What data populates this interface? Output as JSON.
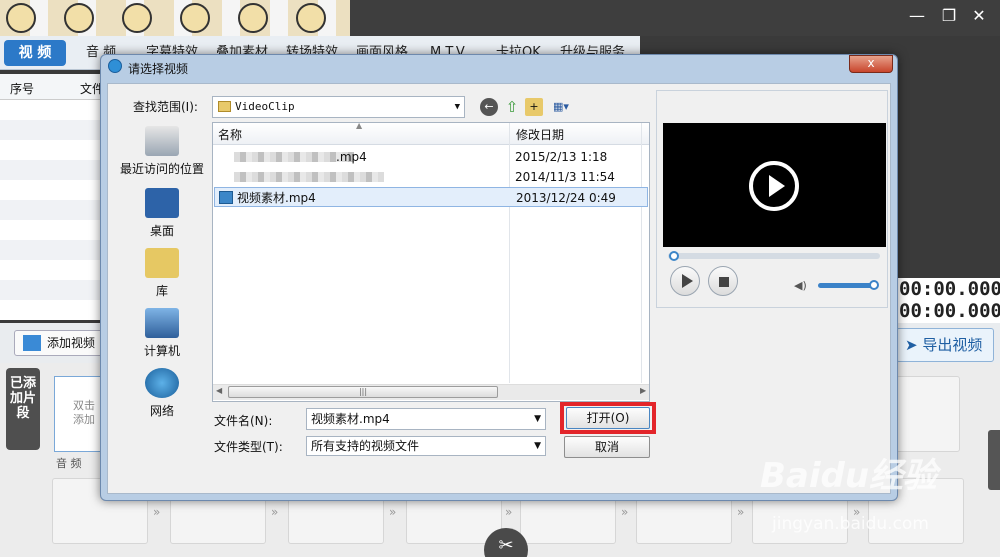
{
  "app": {
    "tabs": [
      "视 频",
      "音 频",
      "字幕特效",
      "叠加素材",
      "转场特效",
      "画面风格",
      "M.T.V.",
      "卡拉OK",
      "升级与服务"
    ],
    "list_cols": [
      "序号",
      "文件"
    ],
    "timecode1": "00:00.000",
    "timecode2": "00:00.000",
    "add_video": "添加视频",
    "export": "导出视频",
    "added_clips": "已添加片段",
    "drop_hint": "双击添加",
    "audio_label": "音 频",
    "window_controls": [
      "minimize-icon",
      "restore-icon",
      "close-icon"
    ]
  },
  "dialog": {
    "title": "请选择视频",
    "lookin_label": "查找范围(I):",
    "lookin_value": "VideoClip",
    "places": [
      "最近访问的位置",
      "桌面",
      "库",
      "计算机",
      "网络"
    ],
    "col_name": "名称",
    "col_date": "修改日期",
    "files": [
      {
        "name": ".mp4",
        "date": "2015/2/13 1:18"
      },
      {
        "name": "",
        "date": "2014/11/3 11:54"
      },
      {
        "name": "视频素材.mp4",
        "date": "2013/12/24 0:49"
      }
    ],
    "fname_label": "文件名(N):",
    "fname_value": "视频素材.mp4",
    "ftype_label": "文件类型(T):",
    "ftype_value": "所有支持的视频文件",
    "open": "打开(O)",
    "cancel": "取消",
    "close": "x"
  },
  "watermark": {
    "brand": "Baidu经验",
    "url": "jingyan.baidu.com"
  },
  "colors": {
    "accent": "#2c79c8",
    "highlight": "#e3252a"
  }
}
